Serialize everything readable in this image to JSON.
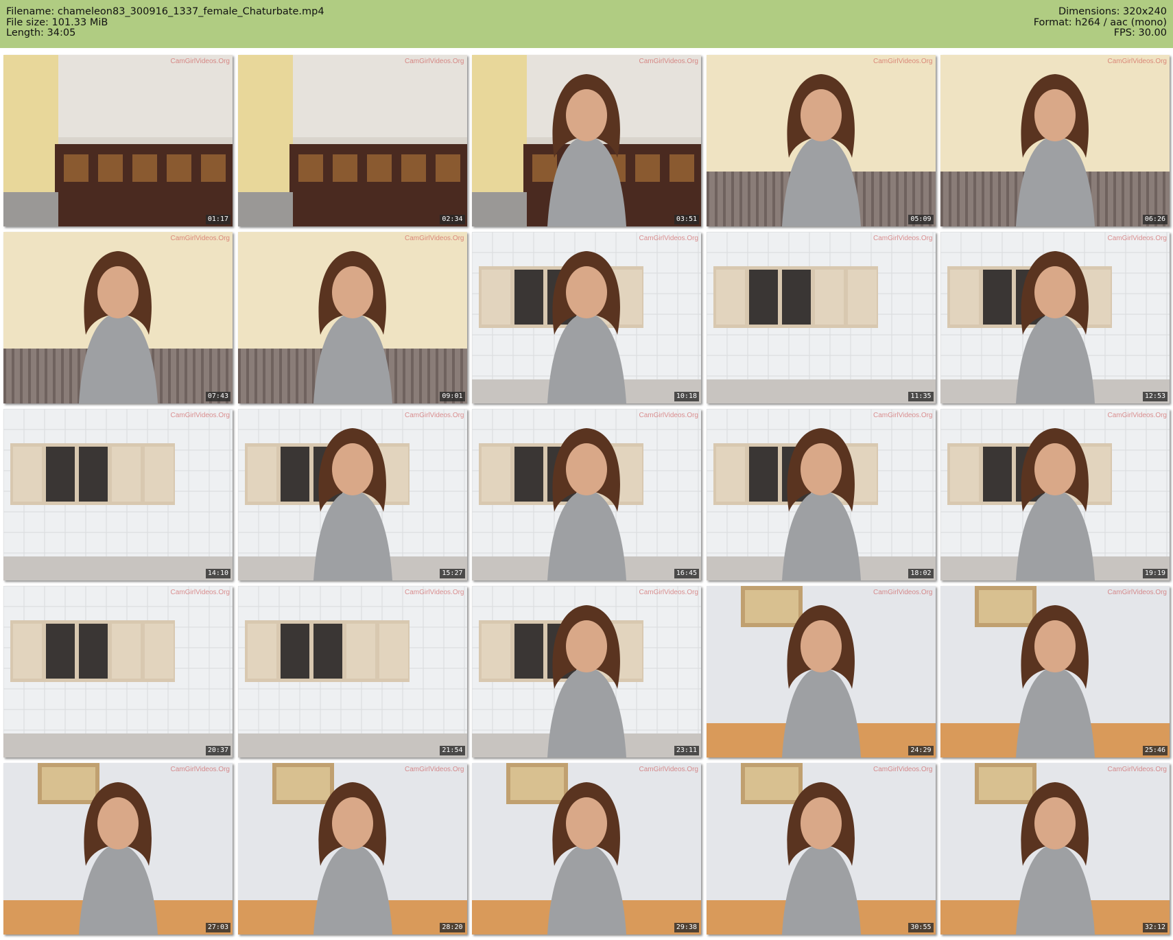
{
  "header": {
    "filename_line": "Filename: chameleon83_300916_1337_female_Chaturbate.mp4",
    "filesize_line": "File size: 101.33 MiB",
    "length_line": "Length: 34:05",
    "dimensions_line": "Dimensions: 320x240",
    "format_line": "Format: h264 / aac (mono)",
    "fps_line": "FPS: 30.00"
  },
  "watermark": "CamGirlVideos.Org",
  "thumbnails": [
    {
      "time": "01:17",
      "scene": "room"
    },
    {
      "time": "02:34",
      "scene": "room"
    },
    {
      "time": "03:51",
      "scene": "room-person"
    },
    {
      "time": "05:09",
      "scene": "sofa-person"
    },
    {
      "time": "06:26",
      "scene": "sofa-person"
    },
    {
      "time": "07:43",
      "scene": "sofa-person"
    },
    {
      "time": "09:01",
      "scene": "sofa-person"
    },
    {
      "time": "10:18",
      "scene": "kitchen-person"
    },
    {
      "time": "11:35",
      "scene": "kitchen"
    },
    {
      "time": "12:53",
      "scene": "kitchen-person"
    },
    {
      "time": "14:10",
      "scene": "kitchen"
    },
    {
      "time": "15:27",
      "scene": "kitchen-person"
    },
    {
      "time": "16:45",
      "scene": "kitchen-person"
    },
    {
      "time": "18:02",
      "scene": "kitchen-person"
    },
    {
      "time": "19:19",
      "scene": "kitchen-person"
    },
    {
      "time": "20:37",
      "scene": "kitchen"
    },
    {
      "time": "21:54",
      "scene": "kitchen"
    },
    {
      "time": "23:11",
      "scene": "kitchen-person"
    },
    {
      "time": "24:29",
      "scene": "bedroom-person"
    },
    {
      "time": "25:46",
      "scene": "bedroom-person"
    },
    {
      "time": "27:03",
      "scene": "bedroom-person"
    },
    {
      "time": "28:20",
      "scene": "bedroom-person"
    },
    {
      "time": "29:38",
      "scene": "bedroom-person"
    },
    {
      "time": "30:55",
      "scene": "bedroom-person"
    },
    {
      "time": "32:12",
      "scene": "bedroom-person"
    }
  ]
}
